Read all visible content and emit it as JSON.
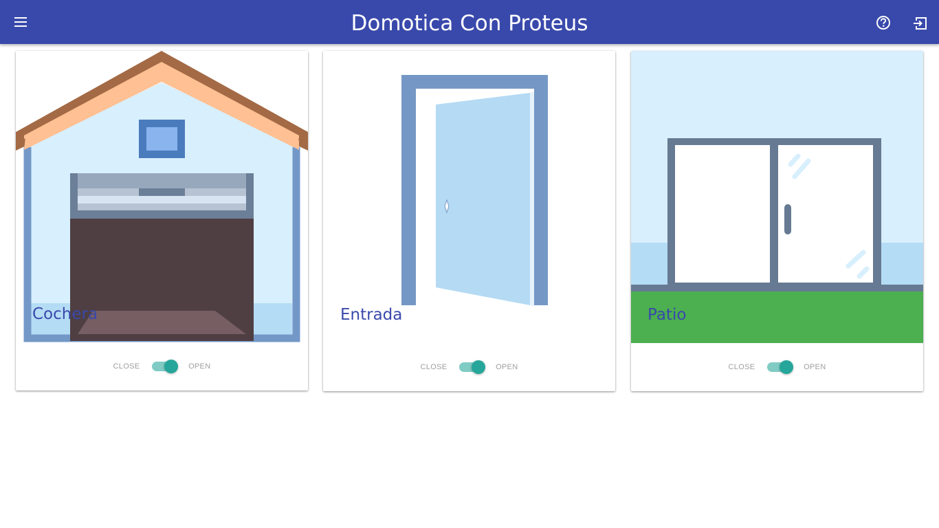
{
  "header": {
    "title": "Domotica Con Proteus",
    "menu_icon": "menu-icon",
    "help_icon": "help-circle-icon",
    "logout_icon": "exit-to-app-icon",
    "background": "#3949ab"
  },
  "cards": [
    {
      "title": "Cochera",
      "image": "garage-illustration",
      "switch": {
        "off_label": "CLOSE",
        "on_label": "OPEN",
        "checked": true
      }
    },
    {
      "title": "Entrada",
      "image": "open-door-illustration",
      "switch": {
        "off_label": "CLOSE",
        "on_label": "OPEN",
        "checked": true
      }
    },
    {
      "title": "Patio",
      "image": "sliding-window-illustration",
      "switch": {
        "off_label": "CLOSE",
        "on_label": "OPEN",
        "checked": true
      }
    }
  ],
  "colors": {
    "accent": "#26a69a",
    "accent_track": "#80cbc4",
    "title_color": "#3949ab"
  }
}
